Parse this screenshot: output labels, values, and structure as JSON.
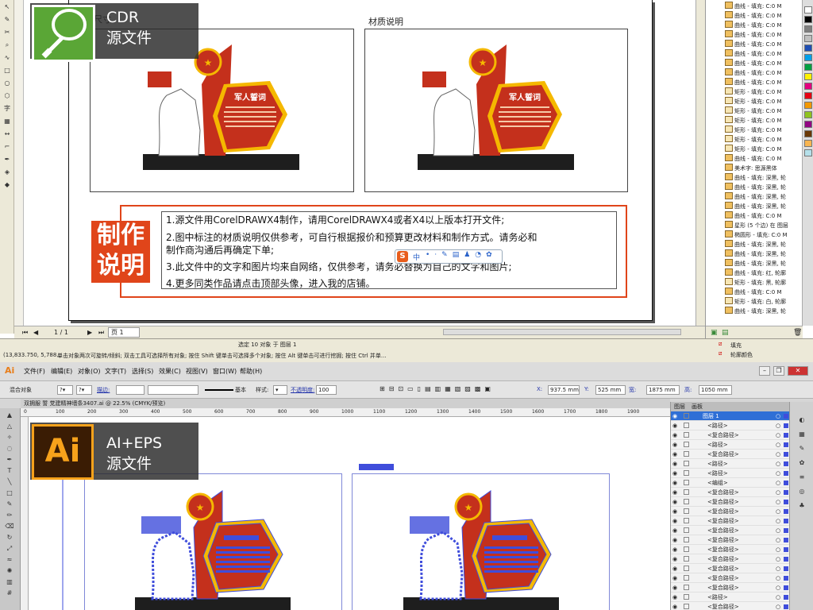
{
  "cdr": {
    "badge": {
      "label": "CDR",
      "sub": "源文件"
    },
    "frame_left_title": "尺寸",
    "frame_right_title": "材质说明",
    "art": {
      "title": "军人誓词"
    },
    "instructions": {
      "heading_line1": "制作",
      "heading_line2": "说明",
      "lines": [
        "1.源文件用CorelDRAWX4制作，请用CorelDRAWX4或者X4以上版本打开文件;",
        "2.图中标注的材质说明仅供参考，可自行根据报价和预算更改材料和制作方式。请务必和",
        "制作商沟通后再确定下单;",
        "3.此文件中的文字和图片均来自网络，仅供参考，请务必替换为自己的文字和图片;",
        "4.更多同类作品请点击顶部头像，进入我的店铺。"
      ]
    },
    "ime_toolbar": "中",
    "pager": {
      "text": "1 / 1",
      "tab": "页 1"
    },
    "status": {
      "selection": "选定 10 对象 于 图层 1",
      "coords": "(13,833.750, 5,788...",
      "hint": "单击对象两次可旋转/倾斜; 双击工具可选择所有对象; 按住 Shift 键单击可选择多个对象; 按住 Alt 键单击可进行挖掘; 按住 Ctrl 并单...",
      "fill": "填充",
      "outline": "轮廓颜色"
    },
    "object_manager": [
      "曲线 - 填充: C:0 M",
      "曲线 - 填充: C:0 M",
      "曲线 - 填充: C:0 M",
      "曲线 - 填充: C:0 M",
      "曲线 - 填充: C:0 M",
      "曲线 - 填充: C:0 M",
      "曲线 - 填充: C:0 M",
      "曲线 - 填充: C:0 M",
      "曲线 - 填充: C:0 M",
      "矩形 - 填充: C:0 M",
      "矩形 - 填充: C:0 M",
      "矩形 - 填充: C:0 M",
      "矩形 - 填充: C:0 M",
      "矩形 - 填充: C:0 M",
      "矩形 - 填充: C:0 M",
      "矩形 - 填充: C:0 M",
      "曲线 - 填充: C:0 M",
      "美术字: 思源黑体",
      "曲线 - 填充: 深黑, 轮",
      "曲线 - 填充: 深黑, 轮",
      "曲线 - 填充: 深黑, 轮",
      "曲线 - 填充: 深黑, 轮",
      "曲线 - 填充: C:0 M",
      "星形 (5 个边) 在 图层",
      "椭圆形 - 填充: C:0 M",
      "曲线 - 填充: 深黑, 轮",
      "曲线 - 填充: 深黑, 轮",
      "曲线 - 填充: 深黑, 轮",
      "曲线 - 填充: 红, 轮廓",
      "矩形 - 填充: 黑, 轮廓",
      "曲线 - 填充: C:0 M",
      "矩形 - 填充: 白, 轮廓",
      "曲线 - 填充: 深黑, 轮"
    ]
  },
  "ai": {
    "badge": {
      "label": "Ai",
      "title": "AI+EPS",
      "sub": "源文件"
    },
    "menu": [
      "文件(F)",
      "编辑(E)",
      "对象(O)",
      "文字(T)",
      "选择(S)",
      "效果(C)",
      "视图(V)",
      "窗口(W)",
      "帮助(H)"
    ],
    "app_icon": "Ai",
    "control": {
      "group_label": "混合对象",
      "stroke_label": "描边:",
      "basic": "基本",
      "style_label": "样式:",
      "opacity_label": "不透明度:",
      "opacity": "100",
      "x_label": "X:",
      "x": "937.5 mm",
      "y_label": "Y:",
      "y": "525 mm",
      "w_label": "宽:",
      "w": "1875 mm",
      "h_label": "高:",
      "h": "1050 mm"
    },
    "doc_tab": "双拥服 誓 党建精神墙条3407.ai @ 22.5% (CMYK/预览)",
    "ruler": [
      "0",
      "100",
      "200",
      "300",
      "400",
      "500",
      "600",
      "700",
      "800",
      "900",
      "1000",
      "1100",
      "1200",
      "1300",
      "1400",
      "1500",
      "1600",
      "1700",
      "1800",
      "1900"
    ],
    "panel_tabs": [
      "图层",
      "画板"
    ],
    "layers": [
      "图层 1",
      "<路径>",
      "<复合路径>",
      "<路径>",
      "<复合路径>",
      "<路径>",
      "<路径>",
      "<编组>",
      "<复合路径>",
      "<复合路径>",
      "<复合路径>",
      "<复合路径>",
      "<复合路径>",
      "<复合路径>",
      "<复合路径>",
      "<复合路径>",
      "<复合路径>",
      "<复合路径>",
      "<复合路径>",
      "<路径>",
      "<复合路径>"
    ]
  },
  "colors": {
    "brand_red": "#e0451a",
    "art_red": "#c4301c",
    "art_gold": "#f5b800",
    "ai_blue": "#3f4ddb",
    "cdr_green": "#5aa636",
    "ai_orange": "#f7a21b"
  }
}
